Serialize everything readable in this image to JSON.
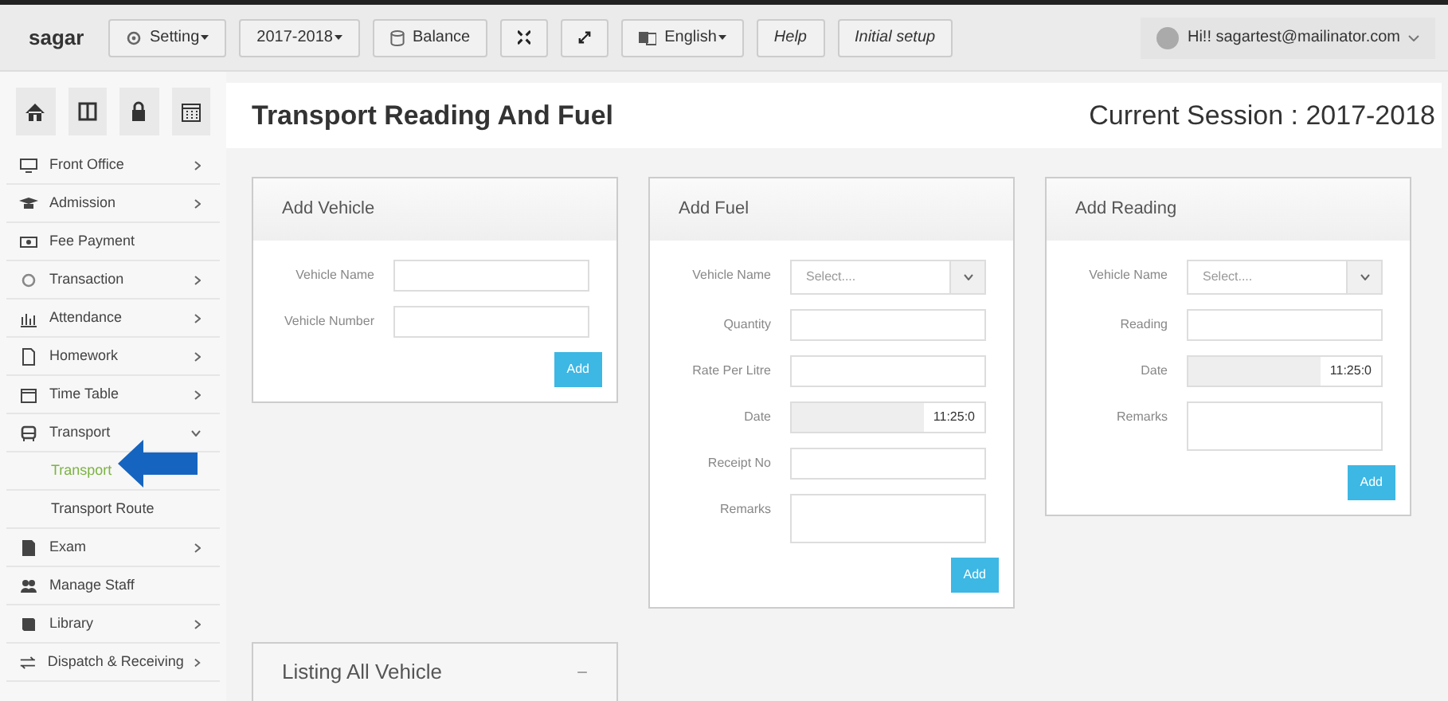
{
  "topbar": {
    "brand": "sagar",
    "buttons": [
      {
        "kind": "text",
        "label": "Setting",
        "dropdown": true,
        "italic": false
      },
      {
        "kind": "text",
        "label": "2017-2018",
        "dropdown": true,
        "italic": false
      },
      {
        "kind": "text",
        "label": "Balance",
        "dropdown": false,
        "italic": false
      },
      {
        "kind": "icon"
      },
      {
        "kind": "icon"
      },
      {
        "kind": "text",
        "label": "English",
        "dropdown": true,
        "italic": false
      },
      {
        "kind": "text",
        "label": "Help",
        "dropdown": false,
        "italic": true
      },
      {
        "kind": "text",
        "label": "Initial setup",
        "dropdown": false,
        "italic": true
      }
    ],
    "user": "Hi!! sagartest@mailinator.com"
  },
  "sidebar": {
    "items": [
      {
        "label": "Front Office",
        "chevron": true,
        "expanded": false
      },
      {
        "label": "Admission",
        "chevron": true,
        "expanded": false
      },
      {
        "label": "Fee Payment",
        "chevron": false
      },
      {
        "label": "Transaction",
        "chevron": true,
        "expanded": false
      },
      {
        "label": "Attendance",
        "chevron": true,
        "expanded": false
      },
      {
        "label": "Homework",
        "chevron": true,
        "expanded": false
      },
      {
        "label": "Time Table",
        "chevron": true,
        "expanded": false
      },
      {
        "label": "Transport",
        "chevron": true,
        "expanded": true,
        "children": [
          {
            "label": "Transport",
            "selected": true
          },
          {
            "label": "Transport Route",
            "selected": false
          }
        ]
      },
      {
        "label": "Exam",
        "chevron": true,
        "expanded": false
      },
      {
        "label": "Manage Staff",
        "chevron": false
      },
      {
        "label": "Library",
        "chevron": true,
        "expanded": false
      },
      {
        "label": "Dispatch & Receiving",
        "chevron": true,
        "expanded": false
      }
    ]
  },
  "page": {
    "title": "Transport Reading And Fuel",
    "session": "Current Session : 2017-2018"
  },
  "cards": [
    {
      "title": "Add Vehicle",
      "fields": [
        {
          "kind": "text",
          "label": "Vehicle Name"
        },
        {
          "kind": "text",
          "label": "Vehicle Number"
        }
      ],
      "button": "Add"
    },
    {
      "title": "Add Fuel",
      "fields": [
        {
          "kind": "select",
          "label": "Vehicle Name",
          "placeholder": "Select...."
        },
        {
          "kind": "text",
          "label": "Quantity"
        },
        {
          "kind": "text",
          "label": "Rate Per Litre"
        },
        {
          "kind": "date",
          "label": "Date",
          "value": "11:25:0"
        },
        {
          "kind": "text",
          "label": "Receipt No"
        },
        {
          "kind": "textarea",
          "label": "Remarks"
        }
      ],
      "button": "Add"
    },
    {
      "title": "Add Reading",
      "fields": [
        {
          "kind": "select",
          "label": "Vehicle Name",
          "placeholder": "Select...."
        },
        {
          "kind": "text",
          "label": "Reading"
        },
        {
          "kind": "date",
          "label": "Date",
          "value": "11:25:0"
        },
        {
          "kind": "textarea",
          "label": "Remarks"
        }
      ],
      "button": "Add"
    }
  ],
  "listing": {
    "title": "Listing All Vehicle",
    "toggle": "−"
  }
}
